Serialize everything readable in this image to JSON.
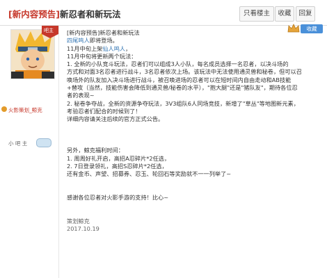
{
  "header": {
    "title_tag": "[新内容预告]",
    "title_text": "新忍者和新玩法",
    "btn_lz": "只看楼主",
    "btn_fav": "收藏",
    "btn_reply": "回复"
  },
  "author": {
    "name": "火影策划_鲸克",
    "level_label": "小 吧 主",
    "badge": "吧主"
  },
  "top_right": {
    "fav_label": "收藏"
  },
  "post": {
    "lines": [
      "[新内容预告]新忍者和新玩法",
      "四尾鸣人即将登场。",
      "11月中旬上架仙人鸣人，",
      "11月中旬将更新两个玩法：",
      "1. 全新的小队竞斗玩法，忍者们可以组成3人小队，每名成员选择一名忍者，以决斗场的",
      "方式和对面3名忍者进行战斗，3名忍者依次上场。该玩法中无法使用通灵兽和秘卷，但可以召",
      "唤场外的队友加入决斗场进行战斗，被召唤进场的忍者可以在短时间内自由走动和AB技能",
      "+替攻（当然，技能伤害会降低到通灵兽/秘卷的水平），\"抱大腿\"还是\"猪队友\"，期待各位忍",
      "者的表现~",
      "2. 秘卷争夺战，全新的资源争夺玩法，3V3组队6人同场竞技，新增了\"草丛\"等地图新元素，",
      "考验忍者们配合的时候到了！",
      "详细内容请关注后续的官方正式公告。",
      "",
      "",
      "",
      "另外，鲸克福利时间：",
      "1. 周周好礼开启，高招A忍碎片*2任选，",
      "2. 7日登录领礼，高招S忍碎片*2任选，",
      "还有金币、声望、招募券、忍玉、轮回石等奖励就不一一列举了~",
      "",
      "",
      "感谢各位忍者对火影手游的支持！比心~",
      "",
      "",
      "策划鲸克",
      "2017.10.19"
    ]
  }
}
